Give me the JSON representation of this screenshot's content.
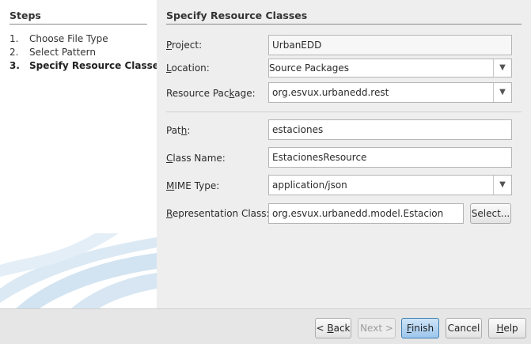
{
  "steps": {
    "title": "Steps",
    "items": [
      {
        "num": "1.",
        "label": "Choose File Type"
      },
      {
        "num": "2.",
        "label": "Select Pattern"
      },
      {
        "num": "3.",
        "label": "Specify Resource Classes"
      }
    ]
  },
  "panel": {
    "title": "Specify Resource Classes"
  },
  "form": {
    "project": {
      "mnemonic": "P",
      "rest": "roject:",
      "value": "UrbanEDD"
    },
    "location": {
      "mnemonic": "L",
      "rest": "ocation:",
      "value": "Source Packages"
    },
    "resource_package": {
      "before": "Resource Pac",
      "mnemonic": "k",
      "after": "age:",
      "value": "org.esvux.urbanedd.rest"
    },
    "path": {
      "before": "Pat",
      "mnemonic": "h",
      "after": ":",
      "value": "estaciones"
    },
    "class_name": {
      "mnemonic": "C",
      "rest": "lass Name:",
      "value": "EstacionesResource"
    },
    "mime_type": {
      "mnemonic": "M",
      "rest": "IME Type:",
      "value": "application/json"
    },
    "representation_class": {
      "mnemonic": "R",
      "rest": "epresentation Class:",
      "value": "org.esvux.urbanedd.model.Estacion",
      "select_label": "Select..."
    }
  },
  "buttons": {
    "back": {
      "prefix": "< ",
      "mnemonic": "B",
      "rest": "ack"
    },
    "next": {
      "label": "Next >"
    },
    "finish": {
      "mnemonic": "F",
      "rest": "inish"
    },
    "cancel": {
      "label": "Cancel"
    },
    "help": {
      "mnemonic": "H",
      "rest": "elp"
    }
  },
  "icons": {
    "dropdown": "▼"
  }
}
